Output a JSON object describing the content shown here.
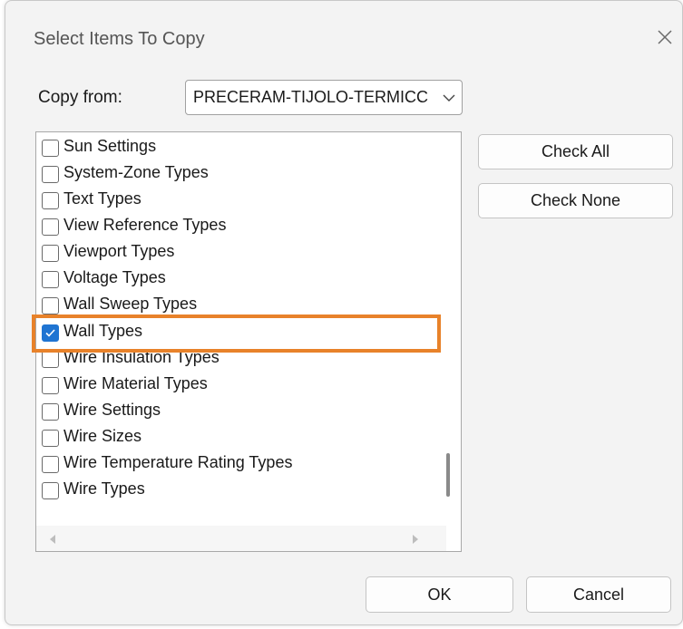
{
  "dialog": {
    "title": "Select Items To Copy",
    "close_icon": "close-icon"
  },
  "copy_from": {
    "label": "Copy from:",
    "value": "PRECERAM-TIJOLO-TERMICC"
  },
  "list": {
    "items": [
      {
        "label": "Sun Settings",
        "checked": false
      },
      {
        "label": "System-Zone Types",
        "checked": false
      },
      {
        "label": "Text Types",
        "checked": false
      },
      {
        "label": "View Reference Types",
        "checked": false
      },
      {
        "label": "Viewport Types",
        "checked": false
      },
      {
        "label": "Voltage Types",
        "checked": false
      },
      {
        "label": "Wall Sweep Types",
        "checked": false
      },
      {
        "label": "Wall Types",
        "checked": true
      },
      {
        "label": "Wire Insulation Types",
        "checked": false
      },
      {
        "label": "Wire Material Types",
        "checked": false
      },
      {
        "label": "Wire Settings",
        "checked": false
      },
      {
        "label": "Wire Sizes",
        "checked": false
      },
      {
        "label": "Wire Temperature Rating Types",
        "checked": false
      },
      {
        "label": "Wire Types",
        "checked": false
      }
    ]
  },
  "buttons": {
    "check_all": "Check All",
    "check_none": "Check None",
    "ok": "OK",
    "cancel": "Cancel"
  },
  "colors": {
    "highlight": "#e8822a",
    "accent": "#1f74d2"
  }
}
